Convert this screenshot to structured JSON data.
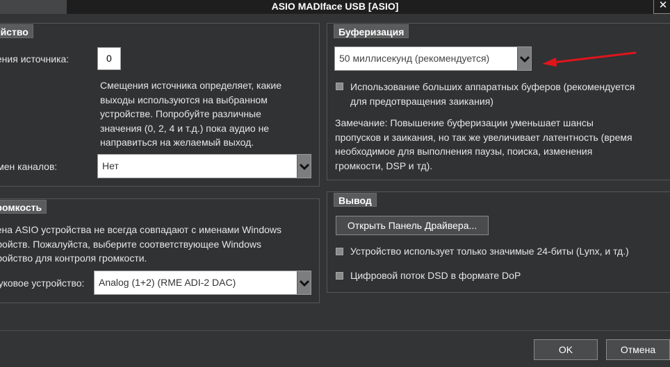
{
  "window": {
    "title": "ASIO MADIface USB [ASIO]",
    "close_glyph": "✕"
  },
  "device_panel": {
    "header": "Устройство",
    "offset_label": "Смещения источника:",
    "offset_value": "0",
    "offset_help": [
      "Смещения источника определяет, какие",
      "выходы используются на выбранном",
      "устройстве. Попробуйте различные",
      "значения (0, 2, 4 и т.д.) пока аудио не",
      "направиться на желаемый выход."
    ],
    "channel_names_label": "Имен каналов:",
    "channel_names_value": "Нет"
  },
  "volume_panel": {
    "header": "Громкость",
    "help": [
      "Имена ASIO устройства не всегда совпадают с именами Windows",
      "устройств. Пожалуйста, выберите соответствующее Windows",
      "устройство для контроля громкости."
    ],
    "sound_device_label": "Звуковое устройство:",
    "sound_device_value": "Analog (1+2) (RME ADI-2 DAC)"
  },
  "buffer_panel": {
    "header": "Буферизация",
    "buffer_value": "50 миллисекунд (рекомендуется)",
    "large_buffers_label": [
      "Использование больших аппаратных буферов (рекомендуется",
      "для предотвращения заикания)"
    ],
    "large_buffers_checked": false,
    "note": [
      "Замечание: Повышение буферизации уменьшает шансы",
      "пропусков и заикания, но так же увеличивает латентность (время",
      "необходимое для выполнения паузы, поиска, изменения",
      "громкости, DSP и тд)."
    ]
  },
  "output_panel": {
    "header": "Вывод",
    "open_driver_button": "Открыть Панель Драйвера...",
    "only_24bit_label": "Устройство использует только значимые 24-биты (Lynx, и тд.)",
    "only_24bit_checked": false,
    "dsd_dop_label": "Цифровой поток DSD в формате DoP",
    "dsd_dop_checked": false
  },
  "footer": {
    "ok_label": "OK",
    "cancel_label": "Отмена"
  },
  "colors": {
    "annotation_arrow": "#e0151b",
    "background": "#333435"
  }
}
